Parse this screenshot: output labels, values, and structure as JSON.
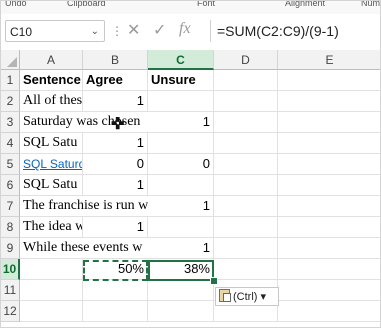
{
  "ribbon": {
    "items": [
      "Undo",
      "Clipboard",
      "Font",
      "Alignment",
      "Number"
    ]
  },
  "formula_bar": {
    "name_box": "C10",
    "formula": "=SUM(C2:C9)/(9-1)",
    "icons": [
      "cancel-icon",
      "enter-icon",
      "function-icon"
    ]
  },
  "sheet": {
    "columns": [
      "A",
      "B",
      "C",
      "D",
      "E"
    ],
    "rows": [
      "1",
      "2",
      "3",
      "4",
      "5",
      "6",
      "7",
      "8",
      "9",
      "10",
      "11",
      "12"
    ],
    "headers": {
      "A1": "Sentence",
      "B1": "Agree",
      "C1": "Unsure"
    },
    "col_a": [
      "All of thes",
      "Saturday was chosen",
      "SQL Satu",
      "SQL Saturd",
      "SQL Satu",
      "The franchise is run w",
      "The idea w",
      "While these events w"
    ],
    "col_b": [
      "1",
      "",
      "1",
      "0",
      "1",
      "",
      "1",
      ""
    ],
    "col_c": [
      "",
      "1",
      "",
      "0",
      "",
      "1",
      "",
      "1"
    ],
    "row10": {
      "B": "50%",
      "C": "38%"
    },
    "selected_cell": "C10"
  },
  "paste_options": {
    "label": "(Ctrl)",
    "dropdown": "▾"
  }
}
